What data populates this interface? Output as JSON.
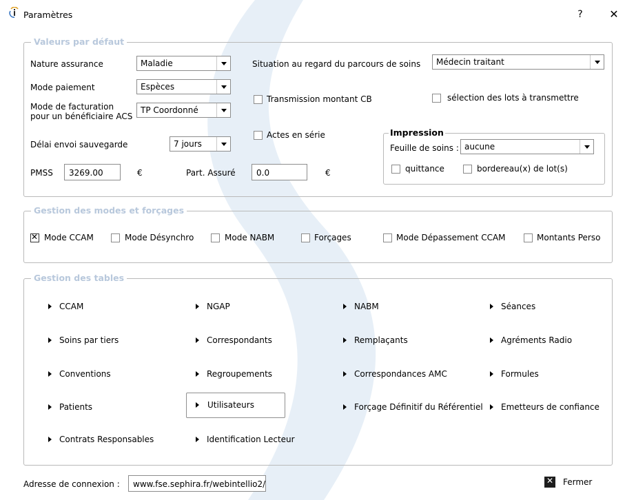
{
  "window": {
    "title": "Paramètres",
    "help": "?",
    "close": "✕"
  },
  "defaults": {
    "legend": "Valeurs par défaut",
    "nature_label": "Nature assurance",
    "nature_value": "Maladie",
    "mode_paiement_label": "Mode paiement",
    "mode_paiement_value": "Espèces",
    "mode_facturation_label_1": "Mode de facturation",
    "mode_facturation_label_2": "pour un bénéficiaire ACS",
    "mode_facturation_value": "TP Coordonné",
    "delai_label": "Délai envoi sauvegarde",
    "delai_value": "7 jours",
    "pmss_label": "PMSS",
    "pmss_value": "3269.00",
    "euro_1": "€",
    "part_assure_label": "Part. Assuré",
    "part_assure_value": "0.0",
    "euro_2": "€",
    "situation_label": "Situation au regard du parcours de soins",
    "situation_value": "Médecin traitant",
    "transmission_label": "Transmission montant CB",
    "selection_lots_label": "sélection des lots à transmettre",
    "actes_serie_label": "Actes en série",
    "impression": {
      "legend": "Impression",
      "feuille_label": "Feuille de soins :",
      "feuille_value": "aucune",
      "quittance_label": "quittance",
      "bordereau_label": "bordereau(x) de lot(s)"
    }
  },
  "modes": {
    "legend": "Gestion des modes et forçages",
    "items": [
      {
        "label": "Mode CCAM",
        "checked": true
      },
      {
        "label": "Mode Désynchro",
        "checked": false
      },
      {
        "label": "Mode NABM",
        "checked": false
      },
      {
        "label": "Forçages",
        "checked": false
      },
      {
        "label": "Mode Dépassement CCAM",
        "checked": false
      },
      {
        "label": "Montants Perso",
        "checked": false
      }
    ]
  },
  "tables": {
    "legend": "Gestion des tables",
    "items": [
      "CCAM",
      "NGAP",
      "NABM",
      "Séances",
      "Soins par tiers",
      "Correspondants",
      "Remplaçants",
      "Agréments Radio",
      "Conventions",
      "Regroupements",
      "Correspondances AMC",
      "Formules",
      "Patients",
      "Utilisateurs",
      "Forçage Définitif du Référentiel",
      "Emetteurs de confiance",
      "Contrats Responsables",
      "Identification Lecteur"
    ],
    "focused": "Utilisateurs"
  },
  "footer": {
    "adresse_label": "Adresse de connexion :",
    "adresse_value": "www.fse.sephira.fr/webintellio2/",
    "fermer_label": "Fermer"
  }
}
